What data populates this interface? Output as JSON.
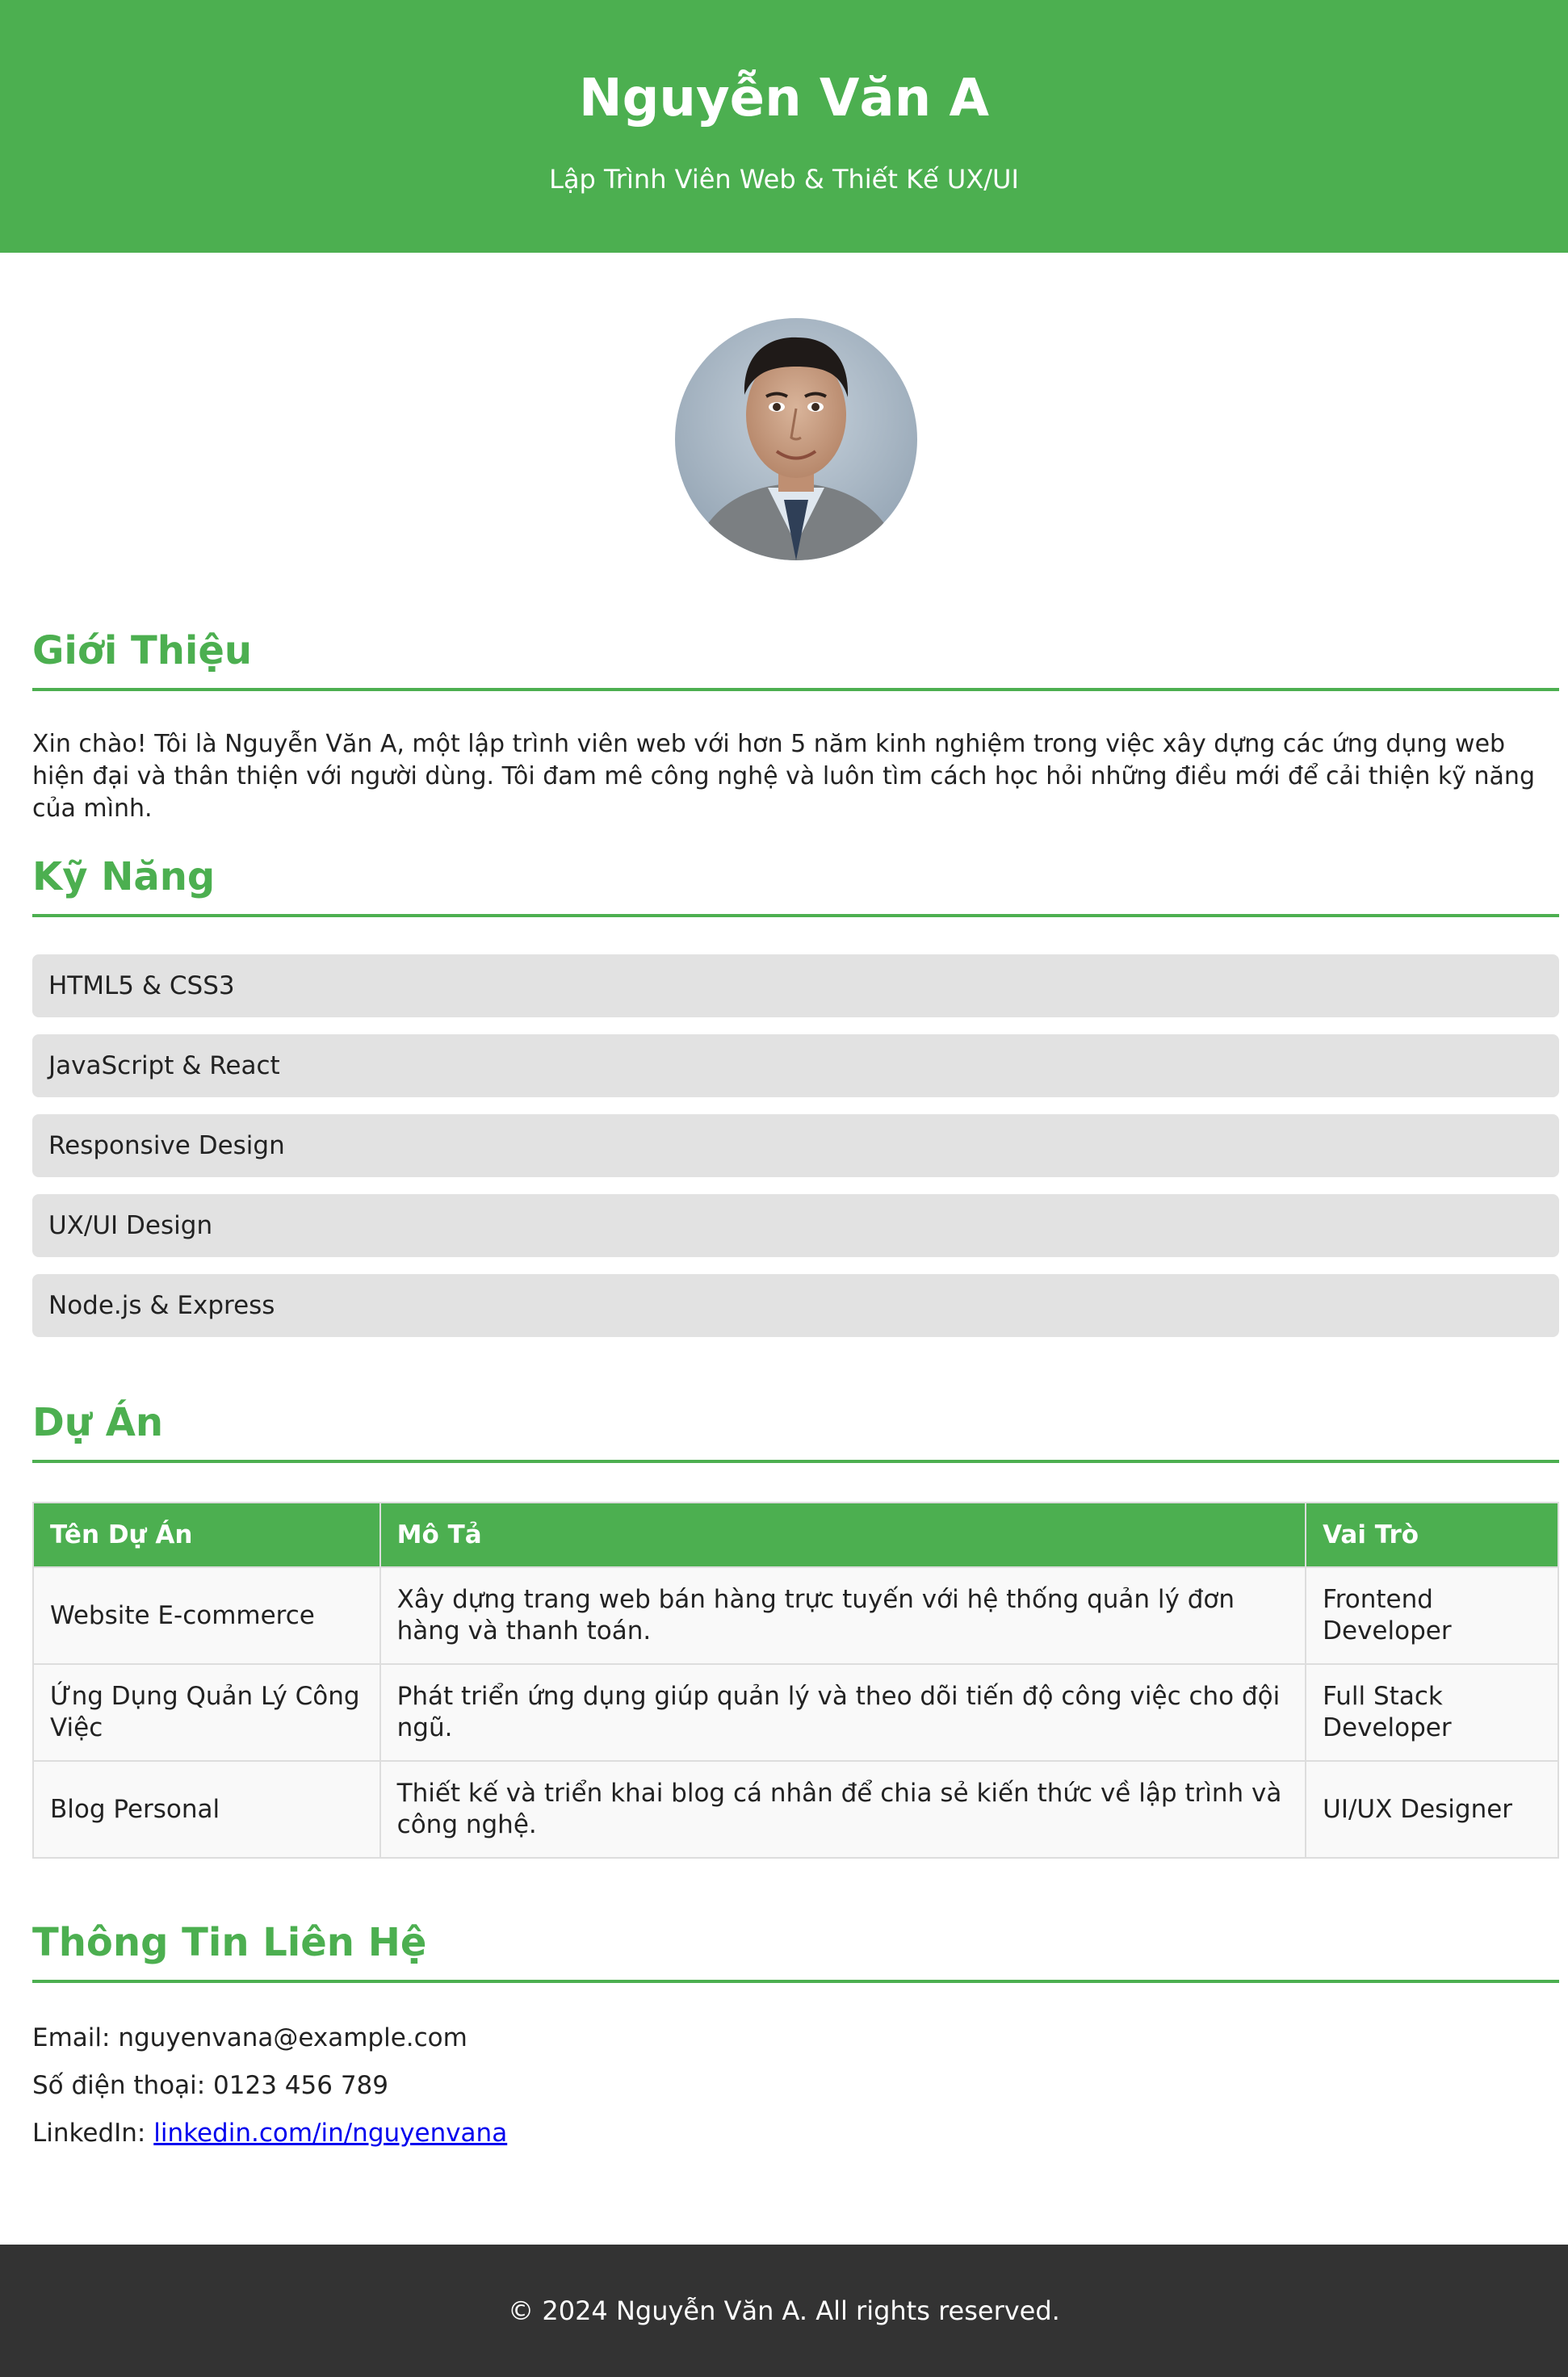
{
  "header": {
    "name": "Nguyễn Văn A",
    "subtitle": "Lập Trình Viên Web & Thiết Kế UX/UI"
  },
  "about": {
    "title": "Giới Thiệu",
    "text": "Xin chào! Tôi là Nguyễn Văn A, một lập trình viên web với hơn 5 năm kinh nghiệm trong việc xây dựng các ứng dụng web hiện đại và thân thiện với người dùng. Tôi đam mê công nghệ và luôn tìm cách học hỏi những điều mới để cải thiện kỹ năng của mình."
  },
  "skills": {
    "title": "Kỹ Năng",
    "items": [
      "HTML5 & CSS3",
      "JavaScript & React",
      "Responsive Design",
      "UX/UI Design",
      "Node.js & Express"
    ]
  },
  "projects": {
    "title": "Dự Án",
    "headers": [
      "Tên Dự Án",
      "Mô Tả",
      "Vai Trò"
    ],
    "rows": [
      [
        "Website E-commerce",
        "Xây dựng trang web bán hàng trực tuyến với hệ thống quản lý đơn hàng và thanh toán.",
        "Frontend Developer"
      ],
      [
        "Ứng Dụng Quản Lý Công Việc",
        "Phát triển ứng dụng giúp quản lý và theo dõi tiến độ công việc cho đội ngũ.",
        "Full Stack Developer"
      ],
      [
        "Blog Personal",
        "Thiết kế và triển khai blog cá nhân để chia sẻ kiến thức về lập trình và công nghệ.",
        "UI/UX Designer"
      ]
    ]
  },
  "contact": {
    "title": "Thông Tin Liên Hệ",
    "email_label": "Email:",
    "email": "nguyenvana@example.com",
    "phone_label": "Số điện thoại:",
    "phone": "0123 456 789",
    "linkedin_label": "LinkedIn:",
    "linkedin": "linkedin.com/in/nguyenvana"
  },
  "footer": {
    "text": "© 2024 Nguyễn Văn A. All rights reserved."
  },
  "colors": {
    "accent": "#4caf50",
    "skill_bg": "#e2e2e2",
    "footer_bg": "#333333",
    "link": "#0000ee"
  }
}
